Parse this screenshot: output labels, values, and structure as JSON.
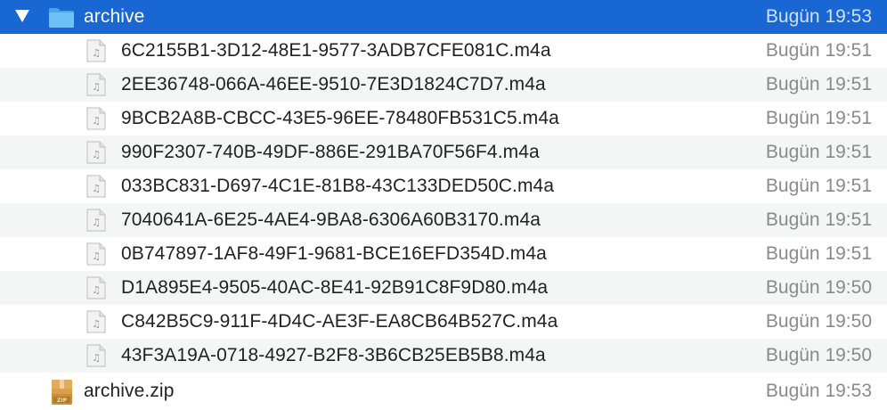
{
  "folder": {
    "name": "archive",
    "date": "Bugün 19:53",
    "expanded": true
  },
  "files": [
    {
      "name": "6C2155B1-3D12-48E1-9577-3ADB7CFE081C.m4a",
      "date": "Bugün 19:51"
    },
    {
      "name": "2EE36748-066A-46EE-9510-7E3D1824C7D7.m4a",
      "date": "Bugün 19:51"
    },
    {
      "name": "9BCB2A8B-CBCC-43E5-96EE-78480FB531C5.m4a",
      "date": "Bugün 19:51"
    },
    {
      "name": "990F2307-740B-49DF-886E-291BA70F56F4.m4a",
      "date": "Bugün 19:51"
    },
    {
      "name": "033BC831-D697-4C1E-81B8-43C133DED50C.m4a",
      "date": "Bugün 19:51"
    },
    {
      "name": "7040641A-6E25-4AE4-9BA8-6306A60B3170.m4a",
      "date": "Bugün 19:51"
    },
    {
      "name": "0B747897-1AF8-49F1-9681-BCE16EFD354D.m4a",
      "date": "Bugün 19:51"
    },
    {
      "name": "D1A895E4-9505-40AC-8E41-92B91C8F9D80.m4a",
      "date": "Bugün 19:50"
    },
    {
      "name": "C842B5C9-911F-4D4C-AE3F-EA8CB64B527C.m4a",
      "date": "Bugün 19:50"
    },
    {
      "name": "43F3A19A-0718-4927-B2F8-3B6CB25EB5B8.m4a",
      "date": "Bugün 19:50"
    }
  ],
  "zip": {
    "name": "archive.zip",
    "date": "Bugün 19:53"
  },
  "colors": {
    "selection": "#1967d2",
    "folder": "#5ab4f0",
    "stripe": "#f4f5f5",
    "date_text": "#8a8a8a"
  },
  "icons": {
    "disclosure": "disclosure-triangle-icon",
    "folder": "folder-icon",
    "audio_file": "audio-file-icon",
    "zip": "zip-archive-icon"
  }
}
